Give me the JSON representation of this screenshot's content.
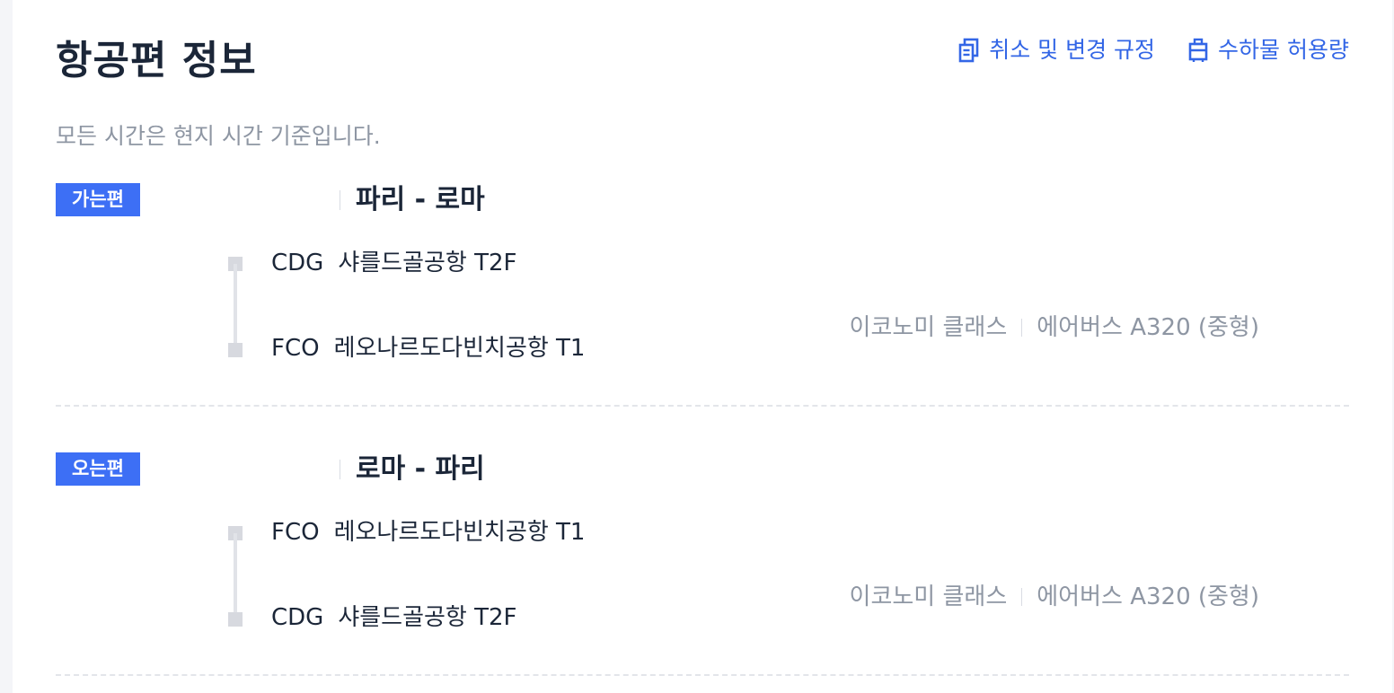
{
  "page_title": "항공편 정보",
  "links": {
    "cancel_rules": "취소 및 변경 규정",
    "baggage": "수하물 허용량"
  },
  "notice": "모든 시간은 현지 시간 기준입니다.",
  "legs": [
    {
      "badge": "가는편",
      "route": "파리 - 로마",
      "departure": {
        "code": "CDG",
        "airport": "샤를드골공항 T2F"
      },
      "arrival": {
        "code": "FCO",
        "airport": "레오나르도다빈치공항 T1"
      },
      "cabin": "이코노미 클래스",
      "aircraft": "에어버스 A320 (중형)"
    },
    {
      "badge": "오는편",
      "route": "로마 - 파리",
      "departure": {
        "code": "FCO",
        "airport": "레오나르도다빈치공항 T1"
      },
      "arrival": {
        "code": "CDG",
        "airport": "샤를드골공항 T2F"
      },
      "cabin": "이코노미 클래스",
      "aircraft": "에어버스 A320 (중형)"
    }
  ],
  "colors": {
    "accent": "#3366e6",
    "badge": "#3d6ff5",
    "title": "#1b2638",
    "muted": "#8e96a3"
  },
  "icons": {
    "cancel_rules": "document-copy-icon",
    "baggage": "luggage-icon"
  }
}
